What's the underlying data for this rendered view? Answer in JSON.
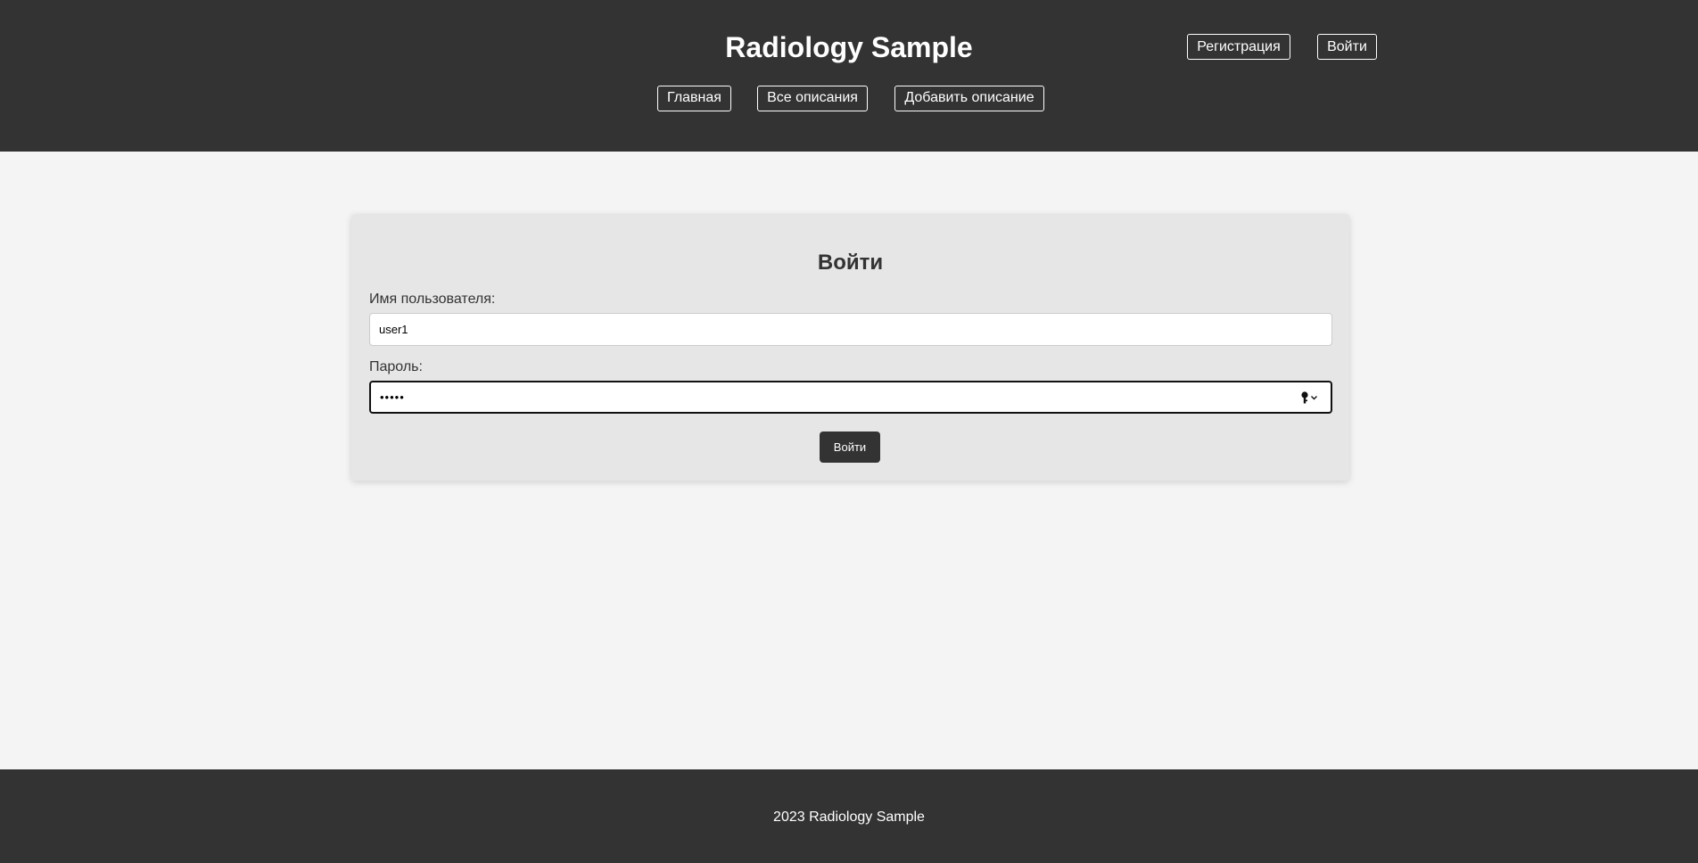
{
  "header": {
    "title": "Radiology Sample",
    "register_label": "Регистрация",
    "login_label": "Войти",
    "nav": {
      "home": "Главная",
      "all_descriptions": "Все описания",
      "add_description": "Добавить описание"
    }
  },
  "login_form": {
    "title": "Войти",
    "username_label": "Имя пользователя:",
    "username_value": "user1",
    "password_label": "Пароль:",
    "password_value": "•••••",
    "password_icon": "key-icon",
    "submit_label": "Войти"
  },
  "footer": {
    "text": "2023 Radiology Sample"
  },
  "colors": {
    "header_bg": "#333333",
    "page_bg": "#f4f4f4",
    "card_bg": "#e6e6e6",
    "button_bg": "#333333"
  }
}
